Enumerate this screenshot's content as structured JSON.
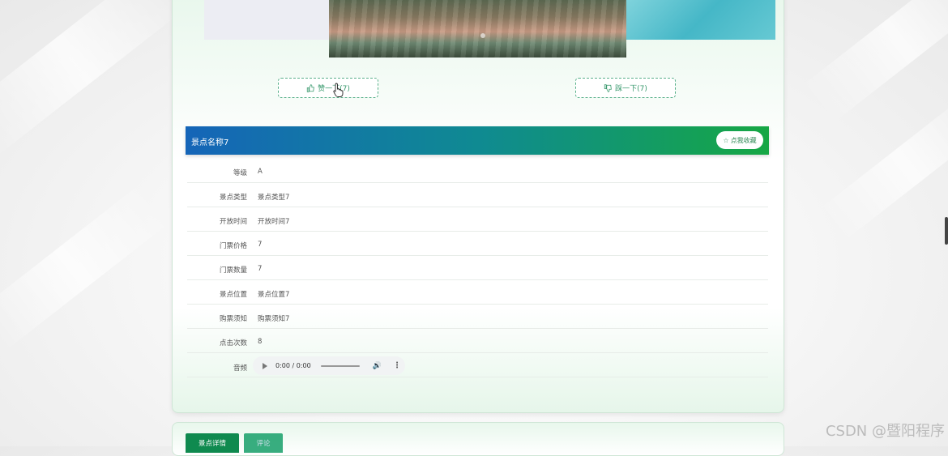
{
  "votes": {
    "like_label": "赞一下(7)",
    "dislike_label": "踩一下(7)"
  },
  "detail": {
    "title": "景点名称7",
    "favorite_label": "点我收藏",
    "rows": [
      {
        "label": "等级",
        "value": "A"
      },
      {
        "label": "景点类型",
        "value": "景点类型7"
      },
      {
        "label": "开放时间",
        "value": "开放时间7"
      },
      {
        "label": "门票价格",
        "value": "7"
      },
      {
        "label": "门票数量",
        "value": "7"
      },
      {
        "label": "景点位置",
        "value": "景点位置7"
      },
      {
        "label": "购票须知",
        "value": "购票须知7"
      },
      {
        "label": "点击次数",
        "value": "8"
      }
    ],
    "audio_label": "音频",
    "audio_time": "0:00 / 0:00"
  },
  "tabs": {
    "detail": "景点详情",
    "comment": "评论"
  },
  "watermark": "CSDN @暨阳程序",
  "icons": {
    "like": "thumbs-up-icon",
    "dislike": "thumbs-down-icon",
    "favorite": "star-icon",
    "play": "play-icon",
    "volume": "volume-icon",
    "more": "more-vertical-icon"
  },
  "colors": {
    "accent_green": "#16a744",
    "accent_blue": "#1565b8"
  }
}
